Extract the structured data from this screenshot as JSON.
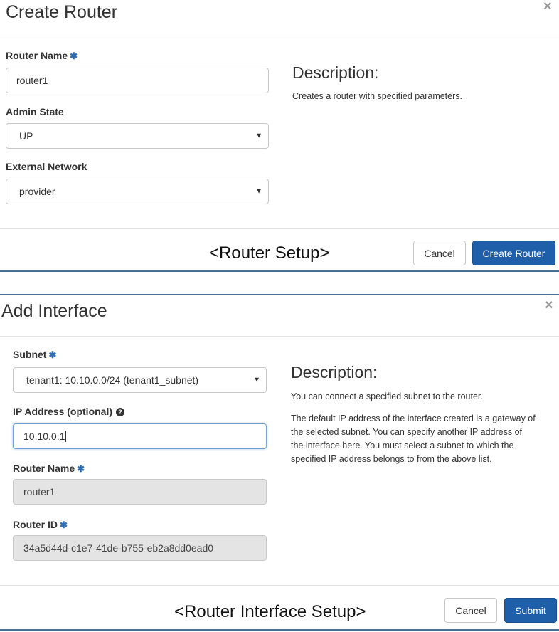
{
  "router_modal": {
    "title": "Create Router",
    "close": "×",
    "router_name_label": "Router Name",
    "router_name_value": "router1",
    "admin_state_label": "Admin State",
    "admin_state_value": "UP",
    "external_network_label": "External Network",
    "external_network_value": "provider",
    "description_title": "Description:",
    "description_text": "Creates a router with specified parameters.",
    "caption": "<Router Setup>",
    "cancel_label": "Cancel",
    "submit_label": "Create Router"
  },
  "interface_modal": {
    "title": "Add Interface",
    "close": "×",
    "subnet_label": "Subnet",
    "subnet_value": "tenant1: 10.10.0.0/24 (tenant1_subnet)",
    "ip_label": "IP Address (optional)",
    "ip_value": "10.10.0.1",
    "router_name_label": "Router Name",
    "router_name_value": "router1",
    "router_id_label": "Router ID",
    "router_id_value": "34a5d44d-c1e7-41de-b755-eb2a8dd0ead0",
    "description_title": "Description:",
    "description_p1": "You can connect a specified subnet to the router.",
    "description_p2": "The default IP address of the interface created is a gateway of the selected subnet. You can specify another IP address of the interface here. You must select a subnet to which the specified IP address belongs to from the above list.",
    "caption": "<Router Interface Setup>",
    "cancel_label": "Cancel",
    "submit_label": "Submit"
  },
  "required_mark": "✱",
  "help_mark": "?"
}
